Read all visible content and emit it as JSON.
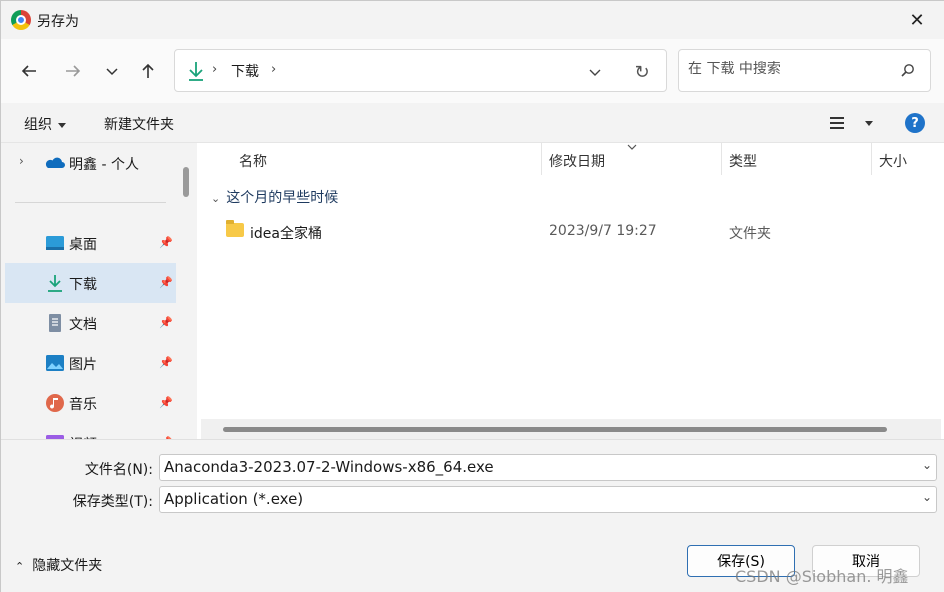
{
  "window": {
    "title": "另存为",
    "close_icon": "close-icon"
  },
  "nav": {
    "back_icon": "back-arrow-icon",
    "forward_icon": "forward-arrow-icon",
    "recent_icon": "chevron-down-icon",
    "up_icon": "up-arrow-icon",
    "address": {
      "path": "下载",
      "separator": "›"
    },
    "search_placeholder": "在 下载 中搜索"
  },
  "toolbar": {
    "organize": "组织",
    "new_folder": "新建文件夹",
    "help": "?"
  },
  "sidebar": {
    "onedrive": {
      "label": "明鑫 - 个人"
    },
    "items": [
      {
        "label": "桌面",
        "icon": "desktop-icon"
      },
      {
        "label": "下载",
        "icon": "download-icon",
        "selected": true
      },
      {
        "label": "文档",
        "icon": "document-icon"
      },
      {
        "label": "图片",
        "icon": "pictures-icon"
      },
      {
        "label": "音乐",
        "icon": "music-icon"
      },
      {
        "label": "视频",
        "icon": "video-icon"
      }
    ]
  },
  "list": {
    "columns": {
      "name": "名称",
      "date": "修改日期",
      "type": "类型",
      "size": "大小"
    },
    "group": "这个月的早些时候",
    "rows": [
      {
        "name": "idea全家桶",
        "date": "2023/9/7 19:27",
        "type": "文件夹"
      }
    ]
  },
  "form": {
    "filename_label": "文件名(N):",
    "filename_value": "Anaconda3-2023.07-2-Windows-x86_64.exe",
    "filetype_label": "保存类型(T):",
    "filetype_value": "Application (*.exe)"
  },
  "footer": {
    "hide_folders": "隐藏文件夹",
    "save": "保存(S)",
    "cancel": "取消",
    "watermark": "CSDN @Siobhan. 明鑫"
  },
  "colors": {
    "accent": "#1f73c9",
    "selected": "#d9e6f3",
    "download_green": "#1aa37a"
  }
}
